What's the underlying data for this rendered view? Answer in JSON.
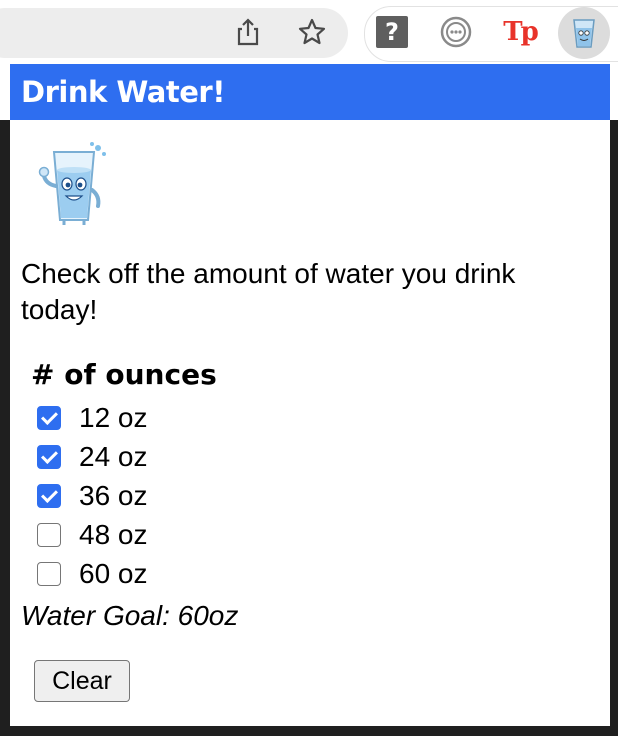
{
  "toolbar": {
    "icons": [
      "share-icon",
      "bookmark-star-icon"
    ],
    "extensions": [
      {
        "name": "help-extension-icon",
        "glyph": "?"
      },
      {
        "name": "dots-extension-icon"
      },
      {
        "name": "tp-extension-icon",
        "glyph": "Tp"
      },
      {
        "name": "water-extension-icon"
      }
    ]
  },
  "popup": {
    "title": "Drink Water!",
    "intro": "Check off the amount of water you drink today!",
    "heading": "# of ounces",
    "options": [
      {
        "label": "12 oz",
        "checked": true
      },
      {
        "label": "24 oz",
        "checked": true
      },
      {
        "label": "36 oz",
        "checked": true
      },
      {
        "label": "48 oz",
        "checked": false
      },
      {
        "label": "60 oz",
        "checked": false
      }
    ],
    "goal": "Water Goal: 60oz",
    "clear_label": "Clear"
  },
  "colors": {
    "header_blue": "#2e6ef0",
    "checkbox_blue": "#2e6ef0",
    "tp_red": "#e8332a"
  }
}
